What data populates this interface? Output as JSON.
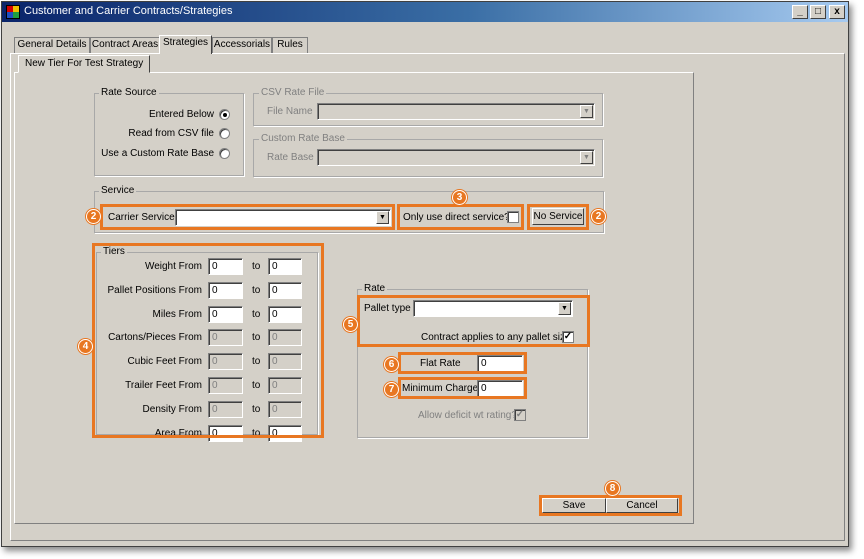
{
  "window": {
    "title": "Customer and Carrier Contracts/Strategies",
    "minimize": "_",
    "maximize": "□",
    "close": "x"
  },
  "tabs": [
    "General Details",
    "Contract Areas",
    "Strategies",
    "Accessorials",
    "Rules"
  ],
  "active_tab": "Strategies",
  "subtab": "New Tier For Test Strategy",
  "rate_source": {
    "label": "Rate Source",
    "options": [
      "Entered Below",
      "Read from CSV file",
      "Use a Custom Rate Base"
    ],
    "selected": "Entered Below"
  },
  "csv_rate_file": {
    "label": "CSV Rate File",
    "field_label": "File Name"
  },
  "custom_rate_base": {
    "label": "Custom Rate Base",
    "field_label": "Rate Base"
  },
  "service": {
    "label": "Service",
    "carrier_service_label": "Carrier Service",
    "direct_service_label": "Only use direct service?",
    "no_service_button": "No Service"
  },
  "tiers": {
    "label": "Tiers",
    "to_label": "to",
    "rows": [
      {
        "label": "Weight From",
        "from": "0",
        "to": "0",
        "enabled": true
      },
      {
        "label": "Pallet Positions From",
        "from": "0",
        "to": "0",
        "enabled": true
      },
      {
        "label": "Miles From",
        "from": "0",
        "to": "0",
        "enabled": true
      },
      {
        "label": "Cartons/Pieces From",
        "from": "0",
        "to": "0",
        "enabled": false
      },
      {
        "label": "Cubic Feet From",
        "from": "0",
        "to": "0",
        "enabled": false
      },
      {
        "label": "Trailer Feet From",
        "from": "0",
        "to": "0",
        "enabled": false
      },
      {
        "label": "Density From",
        "from": "0",
        "to": "0",
        "enabled": false
      },
      {
        "label": "Area From",
        "from": "0",
        "to": "0",
        "enabled": true
      }
    ]
  },
  "rate": {
    "label": "Rate",
    "pallet_type_label": "Pallet type",
    "any_pallet_label": "Contract applies to any pallet size",
    "any_pallet_checked": "✓",
    "flat_rate_label": "Flat Rate",
    "flat_rate_value": "0",
    "minimum_charge_label": "Minimum Charge",
    "minimum_charge_value": "0",
    "allow_deficit_label": "Allow deficit wt rating?",
    "allow_deficit_checked": "✓"
  },
  "buttons": {
    "save": "Save",
    "cancel": "Cancel"
  },
  "callouts": [
    "2",
    "2",
    "3",
    "4",
    "5",
    "6",
    "7",
    "8"
  ],
  "colors": {
    "callout": "#e87722",
    "titlebar_start": "#0a246a",
    "titlebar_end": "#a6caf0",
    "face": "#d4d0c8"
  }
}
